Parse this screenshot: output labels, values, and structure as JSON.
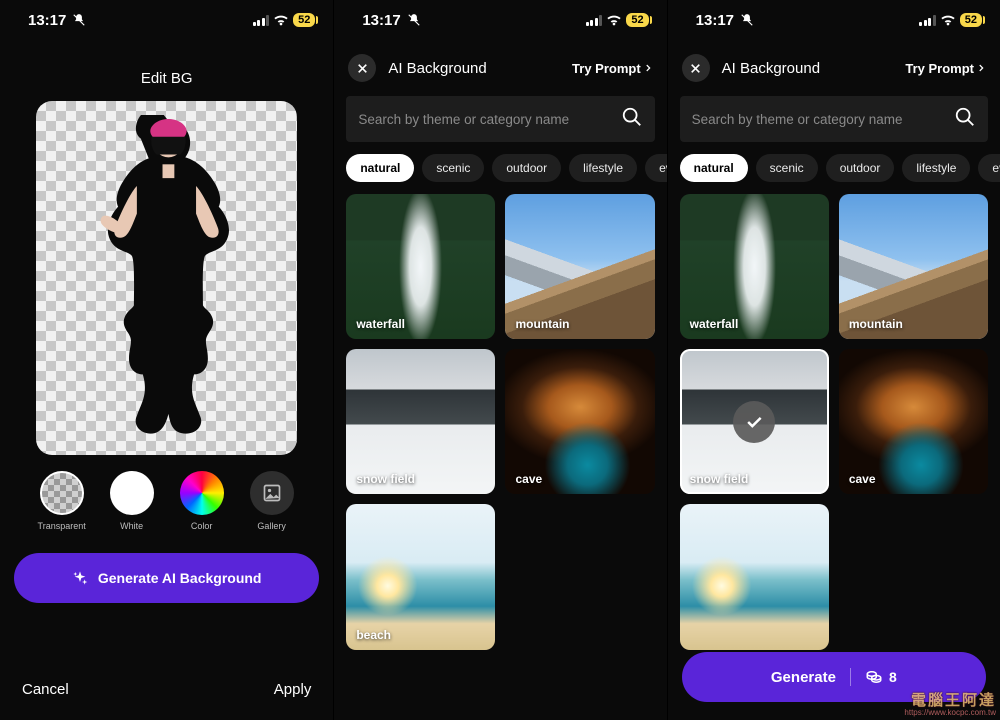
{
  "status": {
    "time": "13:17",
    "battery": "52"
  },
  "panel1": {
    "title": "Edit BG",
    "options": {
      "transparent": "Transparent",
      "white": "White",
      "color": "Color",
      "gallery": "Gallery"
    },
    "cta": "Generate AI Background",
    "cancel": "Cancel",
    "apply": "Apply"
  },
  "aibg": {
    "title": "AI Background",
    "try_prompt": "Try Prompt",
    "search_placeholder": "Search by theme or category name",
    "chips": [
      "natural",
      "scenic",
      "outdoor",
      "lifestyle",
      "events"
    ],
    "tiles": {
      "waterfall": "waterfall",
      "mountain": "mountain",
      "snowfield": "snow field",
      "cave": "cave",
      "beach": "beach"
    },
    "generate": "Generate",
    "credits": "8"
  },
  "watermark": {
    "a": "電腦王阿達",
    "b": "https://www.kocpc.com.tw"
  }
}
